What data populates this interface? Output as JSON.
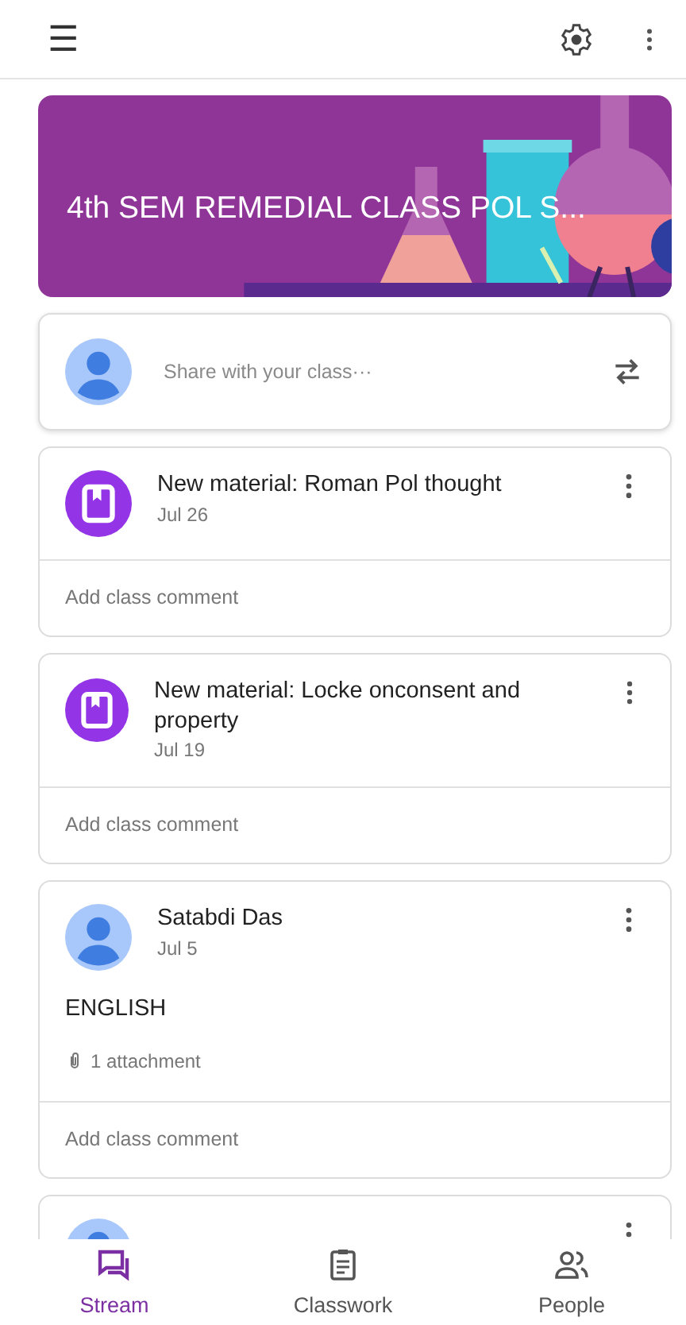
{
  "top_bar": {
    "menu": "☰"
  },
  "banner": {
    "title": "4th SEM REMEDIAL CLASS POL S..."
  },
  "share": {
    "placeholder": "Share with your class···"
  },
  "posts": [
    {
      "kind": "material",
      "title": "New material: Roman Pol thought",
      "date": "Jul 26",
      "comment": "Add class comment"
    },
    {
      "kind": "material",
      "title": "New material: Locke onconsent and property",
      "date": "Jul 19",
      "comment": "Add class comment"
    },
    {
      "kind": "person",
      "title": "Satabdi Das",
      "date": "Jul 5",
      "body": "ENGLISH",
      "attachments": "1 attachment",
      "comment": "Add class comment"
    },
    {
      "kind": "person"
    }
  ],
  "nav": [
    {
      "label": "Stream",
      "kind": "stream",
      "selected": true
    },
    {
      "label": "Classwork",
      "kind": "classwork",
      "selected": false
    },
    {
      "label": "People",
      "kind": "people",
      "selected": false
    }
  ]
}
